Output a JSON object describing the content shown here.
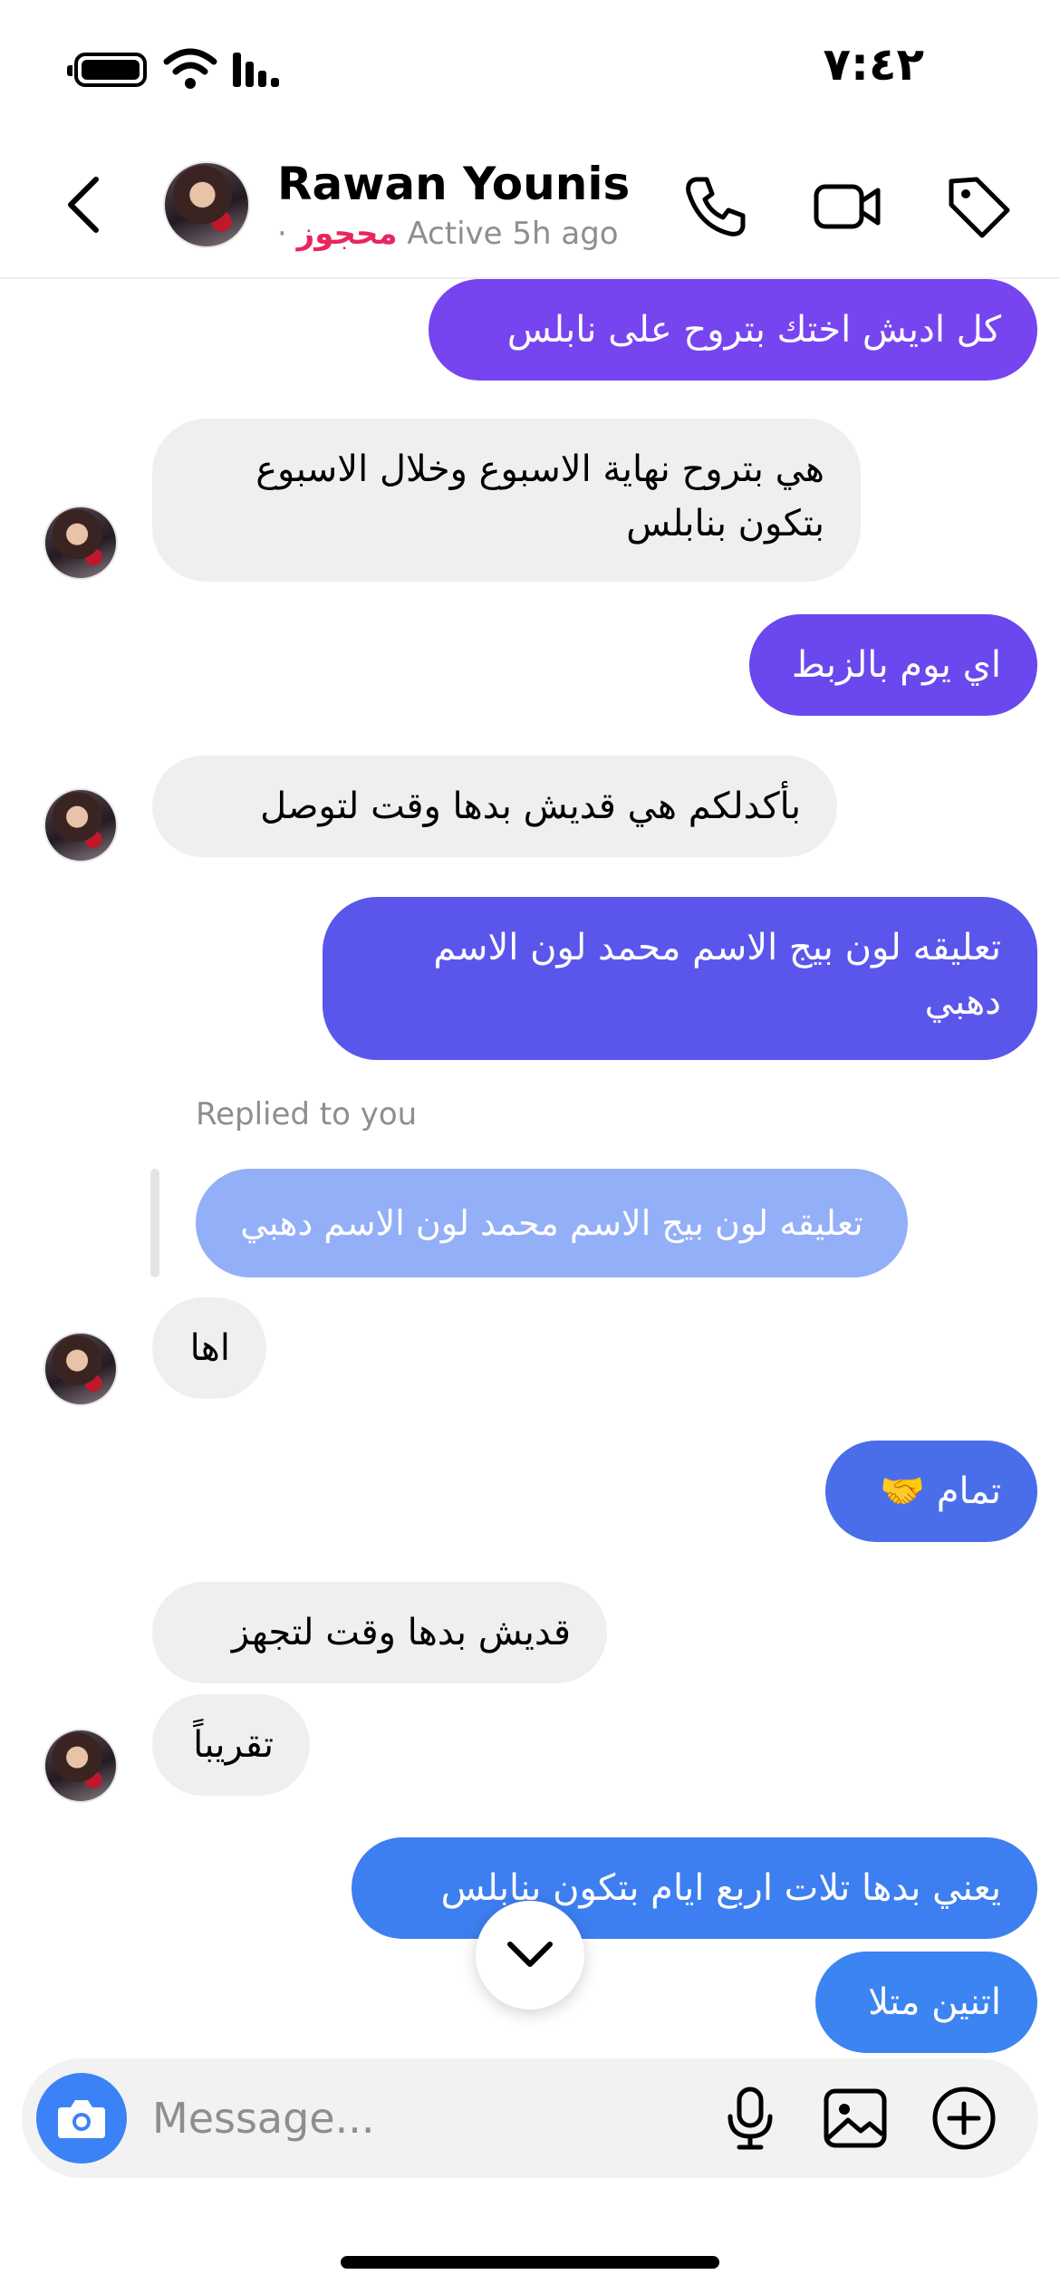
{
  "status_bar": {
    "time": "٧:٤٢"
  },
  "header": {
    "contact_name": "Rawan Younis",
    "status_tag": "محجوز",
    "status_separator": "·",
    "status_text": "Active 5h ago"
  },
  "conversation": {
    "messages": [
      {
        "from": "me",
        "text": "كل اديش اختك بتروح على نابلس",
        "color": "#7645ef"
      },
      {
        "from": "them",
        "text": "هي بتروح نهاية الاسبوع وخلال الاسبوع بتكون بنابلس"
      },
      {
        "from": "me",
        "text": "اي يوم بالزبط",
        "color": "#6a48ee"
      },
      {
        "from": "them",
        "text": "بأكدلكم هي قديش بدها وقت لتوصل"
      },
      {
        "from": "me",
        "text": "تعليقه لون بيج الاسم محمد لون الاسم دهبي",
        "color": "#5a56ec"
      },
      {
        "from": "them",
        "text": "اها"
      },
      {
        "from": "me",
        "text": "تمام 🤝",
        "color": "#4a6eea"
      },
      {
        "from": "them",
        "text": "قديش بدها وقت لتجهز"
      },
      {
        "from": "them",
        "text": "تقريباً"
      },
      {
        "from": "me",
        "text": "يعني بدها تلات اربع ايام بتكون بنابلس",
        "color": "#3d7ff0"
      },
      {
        "from": "me",
        "text": "اتنين متلا",
        "color": "#3b84f1"
      }
    ],
    "reply_label": "Replied to you",
    "replied_text": "تعليقه لون بيج الاسم محمد لون الاسم دهبي"
  },
  "composer": {
    "placeholder": "Message..."
  },
  "icons": {
    "back": "chevron-left-icon",
    "call": "phone-icon",
    "video": "video-camera-icon",
    "tag": "tag-icon",
    "camera": "camera-icon",
    "mic": "microphone-icon",
    "gallery": "image-icon",
    "plus": "plus-circle-icon",
    "scroll": "chevron-down-icon"
  }
}
